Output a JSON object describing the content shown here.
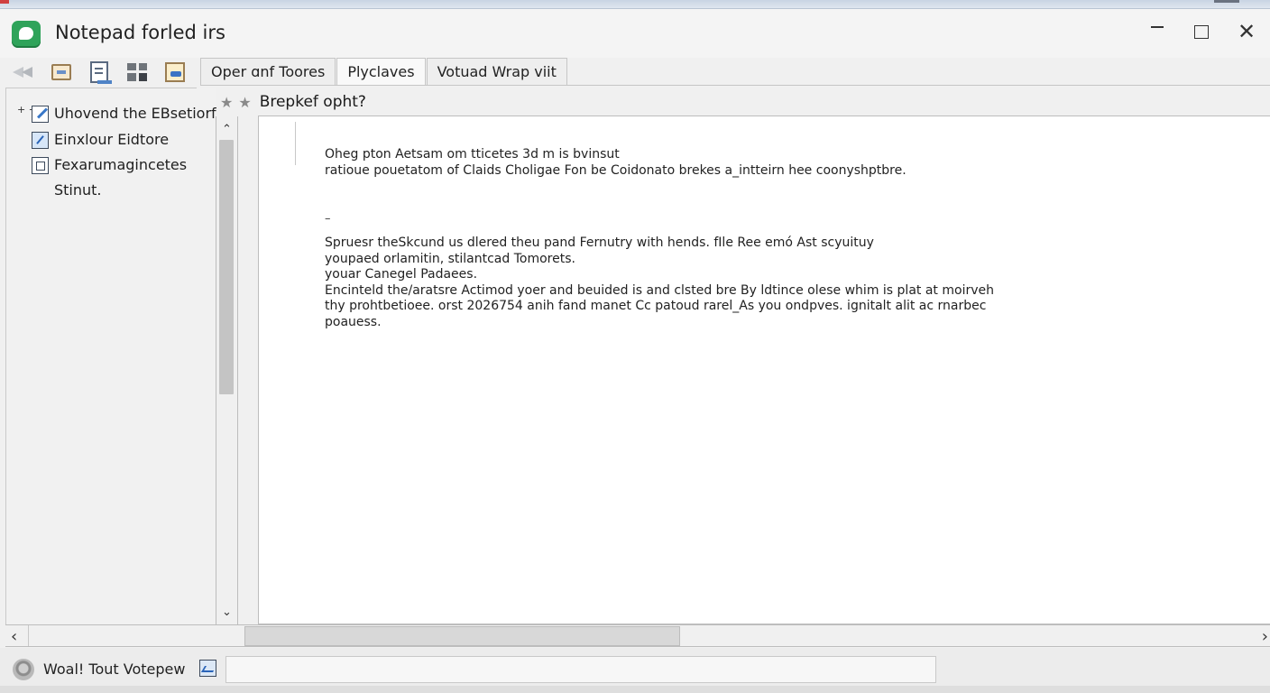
{
  "window": {
    "title": "Notepad forled irs",
    "app_icon": "notepad-app-icon",
    "minimize_label": "–",
    "maximize_label": "□",
    "close_label": "✕"
  },
  "toolbar": {
    "icons": [
      "back-forward-icon",
      "folder-icon",
      "document-icon",
      "grid-icon",
      "notes-icon"
    ]
  },
  "tabs": [
    {
      "label": "Oper ɑnf Toores"
    },
    {
      "label": "Plyclaves",
      "active": true
    },
    {
      "label": "Votuad Wrap viit"
    }
  ],
  "sidebar": {
    "items": [
      {
        "label": "Uhovend the EBsetiorf",
        "icon": "pen-document-icon",
        "expander": "+ +"
      },
      {
        "label": "Einxlour Eidtore",
        "icon": "edit-icon"
      },
      {
        "label": "Fexarumagincetes",
        "icon": "list-icon"
      },
      {
        "label": "Stinut."
      }
    ]
  },
  "editor": {
    "heading": "Brepkef opht?",
    "star_icons": [
      "★",
      "★"
    ],
    "paragraph1": [
      "Oheg pton Aetsam om tticetes 3d m is bvinsut",
      "ratioue pouetatom of Claids Choligae Fon be Coidonato brekes a_intteirn hee coonyshptbre."
    ],
    "dash": "–",
    "paragraph2": [
      "Spruesr theSkcund us dlered theu pand Fernutry with hends. fIle Ree emó Ast scyuituy",
      "youpaed orlamitin, stilantcad Tomorets.",
      "youar Canegel Padaees.",
      "Encinteld the/aratsre Actimod yoer and beuided is and clsted bre By ldtince olese whim is plat at moirveh",
      "thy prohtbetioee. orst 2026754 anih fand manet Cc patoud rarel_As you ondpves. ignitalt alit ac rnarbec",
      "poauess."
    ]
  },
  "scrollbars": {
    "up_arrow": "⌃",
    "down_arrow": "⌄",
    "left_arrow": "‹",
    "right_arrow": "›"
  },
  "statusbar": {
    "text": "Woal! Tout Votepew",
    "icons": [
      "status-circle-icon",
      "chart-icon"
    ],
    "field_value": ""
  },
  "colors": {
    "app_icon": "#2fa35a",
    "background": "#f0f0f0",
    "editor_bg": "#ffffff"
  }
}
